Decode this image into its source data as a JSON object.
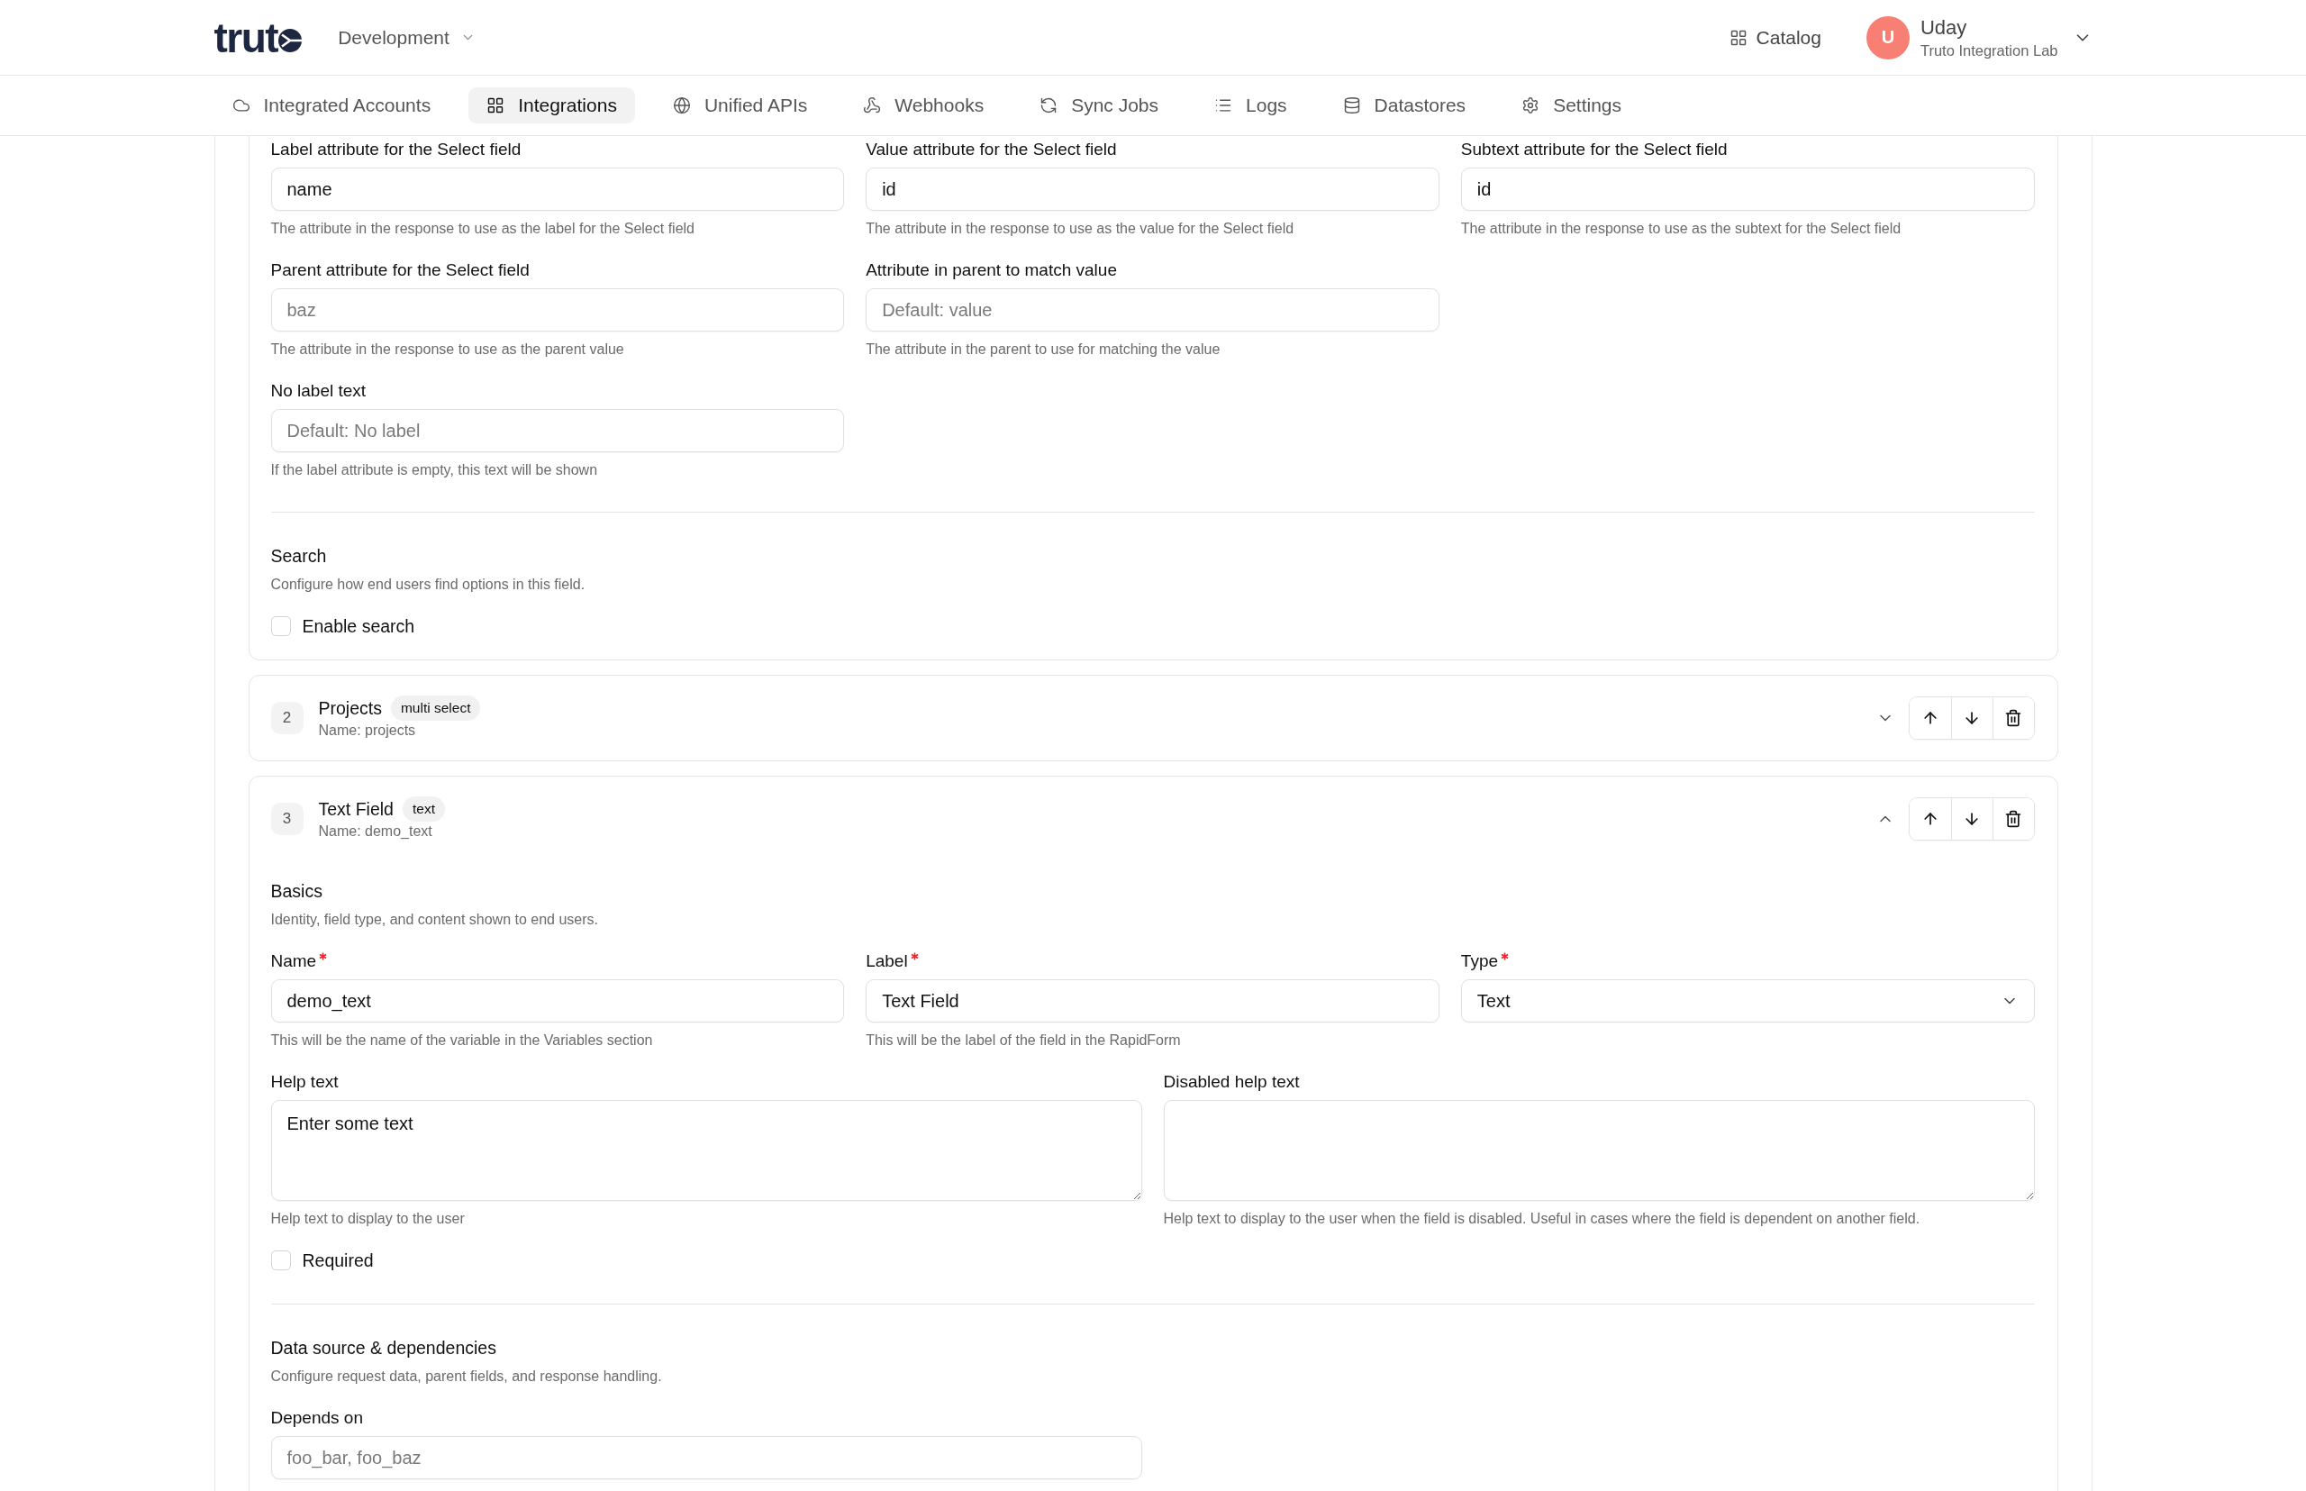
{
  "header": {
    "logo_text": "trut",
    "environment": "Development",
    "catalog_link": "Catalog",
    "user": {
      "initial": "U",
      "name": "Uday",
      "organization": "Truto Integration Lab"
    }
  },
  "nav": {
    "tabs": [
      {
        "label": "Integrated Accounts",
        "selected": false
      },
      {
        "label": "Integrations",
        "selected": true
      },
      {
        "label": "Unified APIs",
        "selected": false
      },
      {
        "label": "Webhooks",
        "selected": false
      },
      {
        "label": "Sync Jobs",
        "selected": false
      },
      {
        "label": "Logs",
        "selected": false
      },
      {
        "label": "Datastores",
        "selected": false
      },
      {
        "label": "Settings",
        "selected": false
      }
    ]
  },
  "select_field_card": {
    "attribute_rows": [
      [
        {
          "label": "Label attribute for the Select field",
          "required": false,
          "kind": "text",
          "value": "name",
          "help": "The attribute in the response to use as the label for the Select field"
        },
        {
          "label": "Value attribute for the Select field",
          "required": false,
          "kind": "text",
          "value": "id",
          "help": "The attribute in the response to use as the value for the Select field"
        },
        {
          "label": "Subtext attribute for the Select field",
          "required": false,
          "kind": "text",
          "value": "id",
          "help": "The attribute in the response to use as the subtext for the Select field"
        }
      ],
      [
        {
          "label": "Parent attribute for the Select field",
          "required": false,
          "kind": "text",
          "placeholder": "baz",
          "help": "The attribute in the response to use as the parent value"
        },
        {
          "label": "Attribute in parent to match value",
          "required": false,
          "kind": "text",
          "placeholder": "Default: value",
          "help": "The attribute in the parent to use for matching the value"
        }
      ],
      [
        {
          "label": "No label text",
          "required": false,
          "kind": "text",
          "placeholder": "Default: No label",
          "help": "If the label attribute is empty, this text will be shown"
        }
      ]
    ],
    "search": {
      "title": "Search",
      "description": "Configure how end users find options in this field.",
      "checkbox": {
        "label": "Enable search",
        "checked": false
      }
    }
  },
  "field_cards": [
    {
      "number": "2",
      "title": "Projects",
      "type": "multi select",
      "name_line": "Name: projects",
      "expanded": false
    },
    {
      "number": "3",
      "title": "Text Field",
      "type": "text",
      "name_line": "Name: demo_text",
      "expanded": true,
      "editor": {
        "basics": {
          "title": "Basics",
          "description": "Identity, field type, and content shown to end users.",
          "fields": [
            {
              "label": "Name",
              "required": true,
              "kind": "text",
              "value": "demo_text",
              "help": "This will be the name of the variable in the Variables section"
            },
            {
              "label": "Label",
              "required": true,
              "kind": "text",
              "value": "Text Field",
              "help": "This will be the label of the field in the RapidForm"
            },
            {
              "label": "Type",
              "required": true,
              "kind": "select",
              "value": "Text"
            }
          ],
          "text_areas": [
            {
              "label": "Help text",
              "required": false,
              "kind": "textarea",
              "value": "Enter some text",
              "help": "Help text to display to the user"
            },
            {
              "label": "Disabled help text",
              "required": false,
              "kind": "textarea",
              "help": "Help text to display to the user when the field is disabled. Useful in cases where the field is dependent on another field."
            }
          ],
          "required_checkbox": {
            "label": "Required",
            "checked": false
          }
        },
        "data_source": {
          "title": "Data source & dependencies",
          "description": "Configure request data, parent fields, and response handling.",
          "fields": [
            {
              "label": "Depends on",
              "required": false,
              "kind": "text",
              "placeholder": "foo_bar, foo_baz"
            }
          ]
        }
      }
    }
  ]
}
